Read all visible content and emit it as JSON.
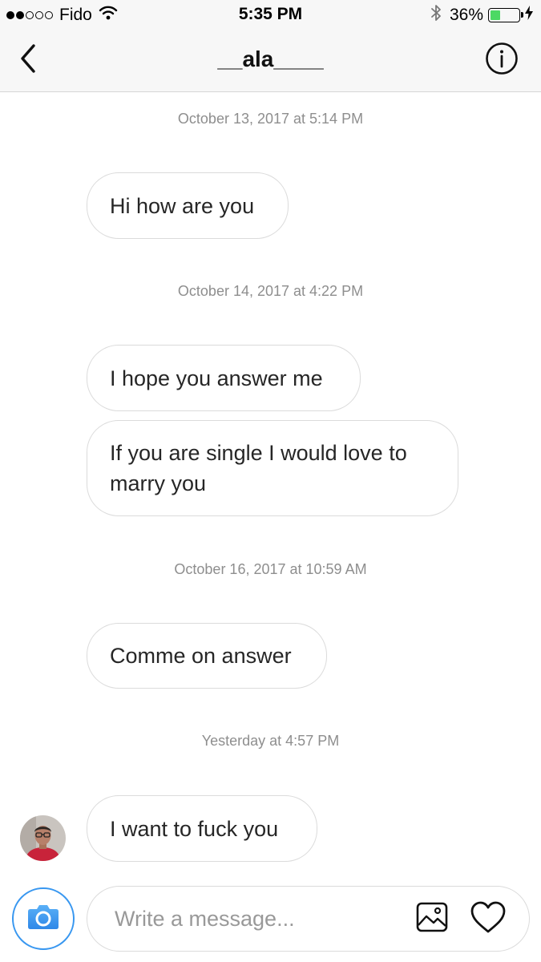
{
  "status_bar": {
    "carrier": "Fido",
    "time": "5:35 PM",
    "battery_percent": "36%",
    "battery_level": 0.36,
    "signal_bars_filled": 2,
    "signal_bars_total": 5,
    "icons": [
      "wifi-icon",
      "bluetooth-icon",
      "battery-icon",
      "charging-icon"
    ]
  },
  "header": {
    "title": "__ala____",
    "back_icon": "chevron-left-icon",
    "info_icon": "info-icon"
  },
  "conversation": {
    "timestamps": [
      "October 13, 2017 at 5:14 PM",
      "October 14, 2017 at 4:22 PM",
      "October 16, 2017 at 10:59 AM",
      "Yesterday at 4:57 PM"
    ],
    "messages": [
      "Hi how are you",
      "I hope you answer me",
      "If you are single I would love to\nmarry you",
      "Comme on answer",
      "I want to fuck you"
    ]
  },
  "composer": {
    "placeholder": "Write a message...",
    "camera_icon": "camera-icon",
    "gallery_icon": "image-icon",
    "like_icon": "heart-icon"
  },
  "colors": {
    "accent": "#3897f0",
    "bubble_border": "#dbdbdb",
    "timestamp": "#8e8e8e",
    "battery": "#4cd964"
  }
}
